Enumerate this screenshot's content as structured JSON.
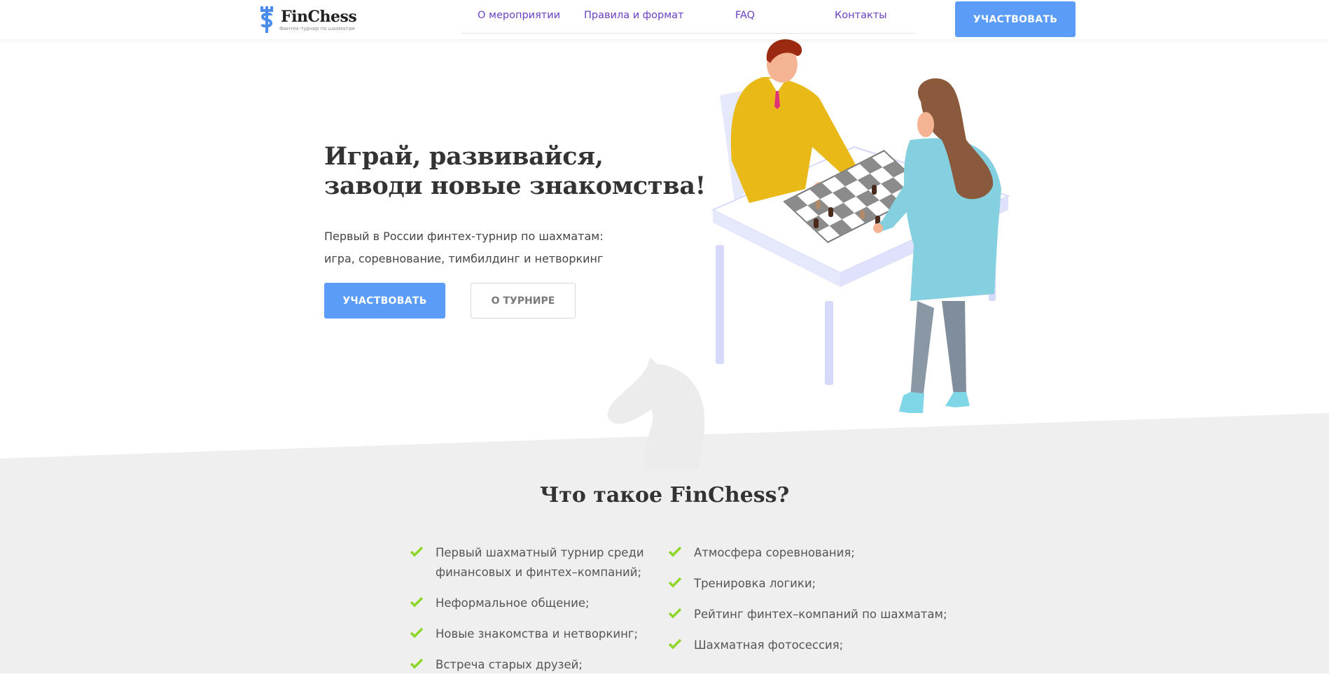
{
  "brand": {
    "name": "FinChess",
    "tagline": "Финтех-турнир по шахматам",
    "accent_color": "#5a9cf8",
    "nav_color": "#6a3fc4",
    "check_color": "#8fd62a"
  },
  "nav": {
    "items": [
      {
        "label": "О мероприятии"
      },
      {
        "label": "Правила и формат"
      },
      {
        "label": "FAQ"
      },
      {
        "label": "Контакты"
      }
    ],
    "cta_label": "УЧАСТВОВАТЬ"
  },
  "hero": {
    "title_line1": "Играй, развивайся,",
    "title_line2": "заводи новые знакомства!",
    "subtitle_line1": "Первый в России финтех-турнир по шахматам:",
    "subtitle_line2": "игра, соревнование, тимбилдинг и нетворкинг",
    "primary_button": "УЧАСТВОВАТЬ",
    "secondary_button": "О ТУРНИРЕ"
  },
  "about": {
    "title": "Что такое FinChess?",
    "col1": [
      {
        "text": "Первый шахматный турнир среди финансовых и финтех–компаний;"
      },
      {
        "text": "Неформальное общение;"
      },
      {
        "text": "Новые знакомства и нетворкинг;"
      },
      {
        "text": "Встреча старых друзей;"
      }
    ],
    "col2": [
      {
        "text": "Атмосфера соревнования;"
      },
      {
        "text": "Тренировка логики;"
      },
      {
        "text": "Рейтинг финтех–компаний по шахматам;"
      },
      {
        "text": "Шахматная фотосессия;"
      }
    ]
  },
  "icons": {
    "logo": "rook-dollar-logo-icon",
    "feature_bullet": "check-icon",
    "decor": "chess-knight-icon"
  }
}
